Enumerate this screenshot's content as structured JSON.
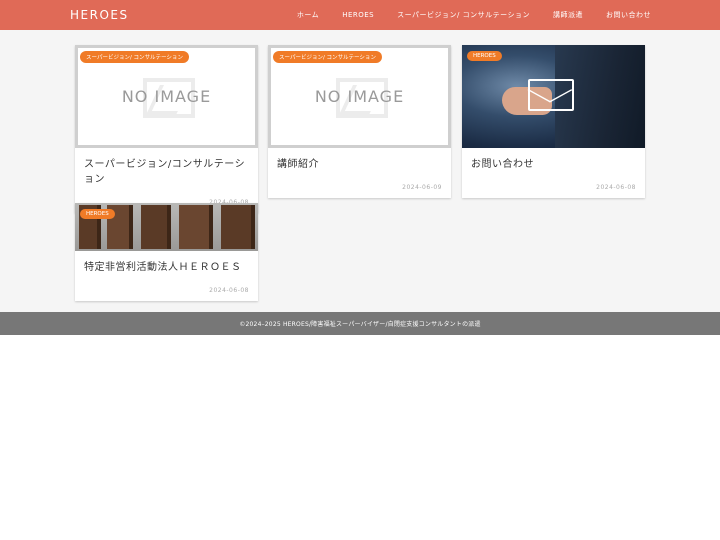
{
  "header": {
    "logo": "HEROES",
    "nav": [
      "ホーム",
      "HEROES",
      "スーパービジョン/ コンサルテーション",
      "講師派遣",
      "お問い合わせ"
    ]
  },
  "cards": [
    {
      "category": "スーパービジョン/ コンサルテーション",
      "image_text": "NO IMAGE",
      "title": "スーパービジョン/コンサルテーション",
      "date": "2024-06-08"
    },
    {
      "category": "スーパービジョン/ コンサルテーション",
      "image_text": "NO IMAGE",
      "title": "講師紹介",
      "date": "2024-06-09"
    },
    {
      "category": "HEROES",
      "image_text": "",
      "title": "お問い合わせ",
      "date": "2024-06-08"
    },
    {
      "category": "HEROES",
      "image_text": "",
      "title": "特定非営利活動法人ＨＥＲＯＥＳ",
      "date": "2024-06-08"
    }
  ],
  "footer": {
    "copyright": "©2024–2025  HEROES/障害福祉スーパーバイザー/自閉症支援コンサルタントの派遣"
  },
  "colors": {
    "header_bg": "#e06a57",
    "badge_bg": "#f07b27",
    "footer_bg": "#777777",
    "main_bg": "#f5f5f5"
  }
}
